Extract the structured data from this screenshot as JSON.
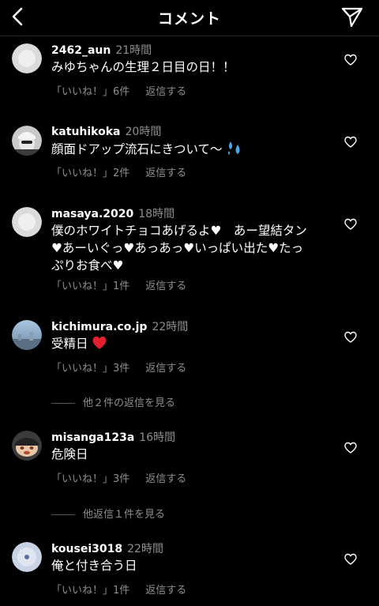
{
  "header": {
    "title": "コメント"
  },
  "comments": [
    {
      "username": "2462_aun",
      "time": "21時間",
      "text": "みゆちゃんの生理２日目の日！！",
      "likes": "「いいね！」6件",
      "reply": "返信する"
    },
    {
      "username": "katuhikoka",
      "time": "20時間",
      "text": "顔面ドアップ流石にきついて〜",
      "likes": "「いいね！」2件",
      "reply": "返信する"
    },
    {
      "username": "masaya.2020",
      "time": "18時間",
      "text_line1": "僕のホワイトチョコあげるよ♥　あー望結タン",
      "text_line2": "♥あーいぐっ♥あっあっ♥いっぱい出た♥たっ",
      "text_line3": "ぷりお食べ♥",
      "likes": "「いいね！」1件",
      "reply": "返信する"
    },
    {
      "username": "kichimura.co.jp",
      "time": "22時間",
      "text": "受精日",
      "likes": "「いいね！」3件",
      "reply": "返信する",
      "view_replies": "他２件の返信を見る"
    },
    {
      "username": "misanga123a",
      "time": "16時間",
      "text": "危険日",
      "likes": "「いいね！」3件",
      "reply": "返信する",
      "view_replies": "他返信１件を見る"
    },
    {
      "username": "kousei3018",
      "time": "22時間",
      "text": "俺と付き合う日",
      "likes": "「いいね！」1件",
      "reply": "返信する"
    }
  ]
}
